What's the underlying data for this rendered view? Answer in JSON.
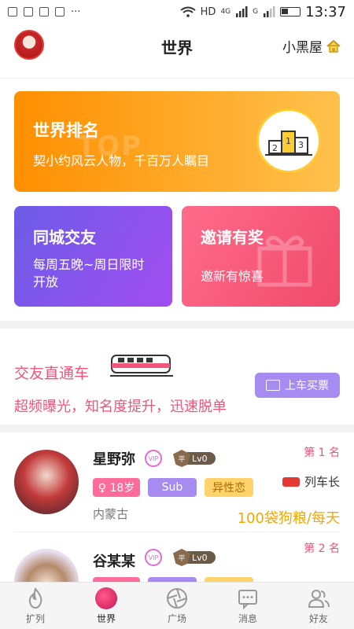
{
  "status_bar": {
    "network": "HD",
    "signal_4g": "4G",
    "signal_g": "G",
    "time": "13:37"
  },
  "header": {
    "title": "世界",
    "room_link": "小黑屋"
  },
  "cards": {
    "ranking": {
      "title": "世界排名",
      "subtitle": "契小约风云人物，千百万人瞩目",
      "watermark": "TOP"
    },
    "city": {
      "title": "同城交友",
      "subtitle": "每周五晚~周日限时开放"
    },
    "invite": {
      "title": "邀请有奖",
      "subtitle": "邀新有惊喜"
    }
  },
  "promo": {
    "title": "交友直通车",
    "subtitle": "超频曝光，知名度提升，迅速脱单",
    "button": "上车买票"
  },
  "users": [
    {
      "place": "第 1 名",
      "name": "星野弥",
      "level": "Lv0",
      "age": "♀ 18岁",
      "role": "Sub",
      "orientation": "异性恋",
      "location": "内蒙古",
      "title": "列车长",
      "reward": "100袋狗粮/每天"
    },
    {
      "place": "第 2 名",
      "name": "谷某某",
      "level": "Lv0"
    }
  ],
  "tabs": [
    {
      "label": "扩列"
    },
    {
      "label": "世界"
    },
    {
      "label": "广场"
    },
    {
      "label": "消息"
    },
    {
      "label": "好友"
    }
  ]
}
